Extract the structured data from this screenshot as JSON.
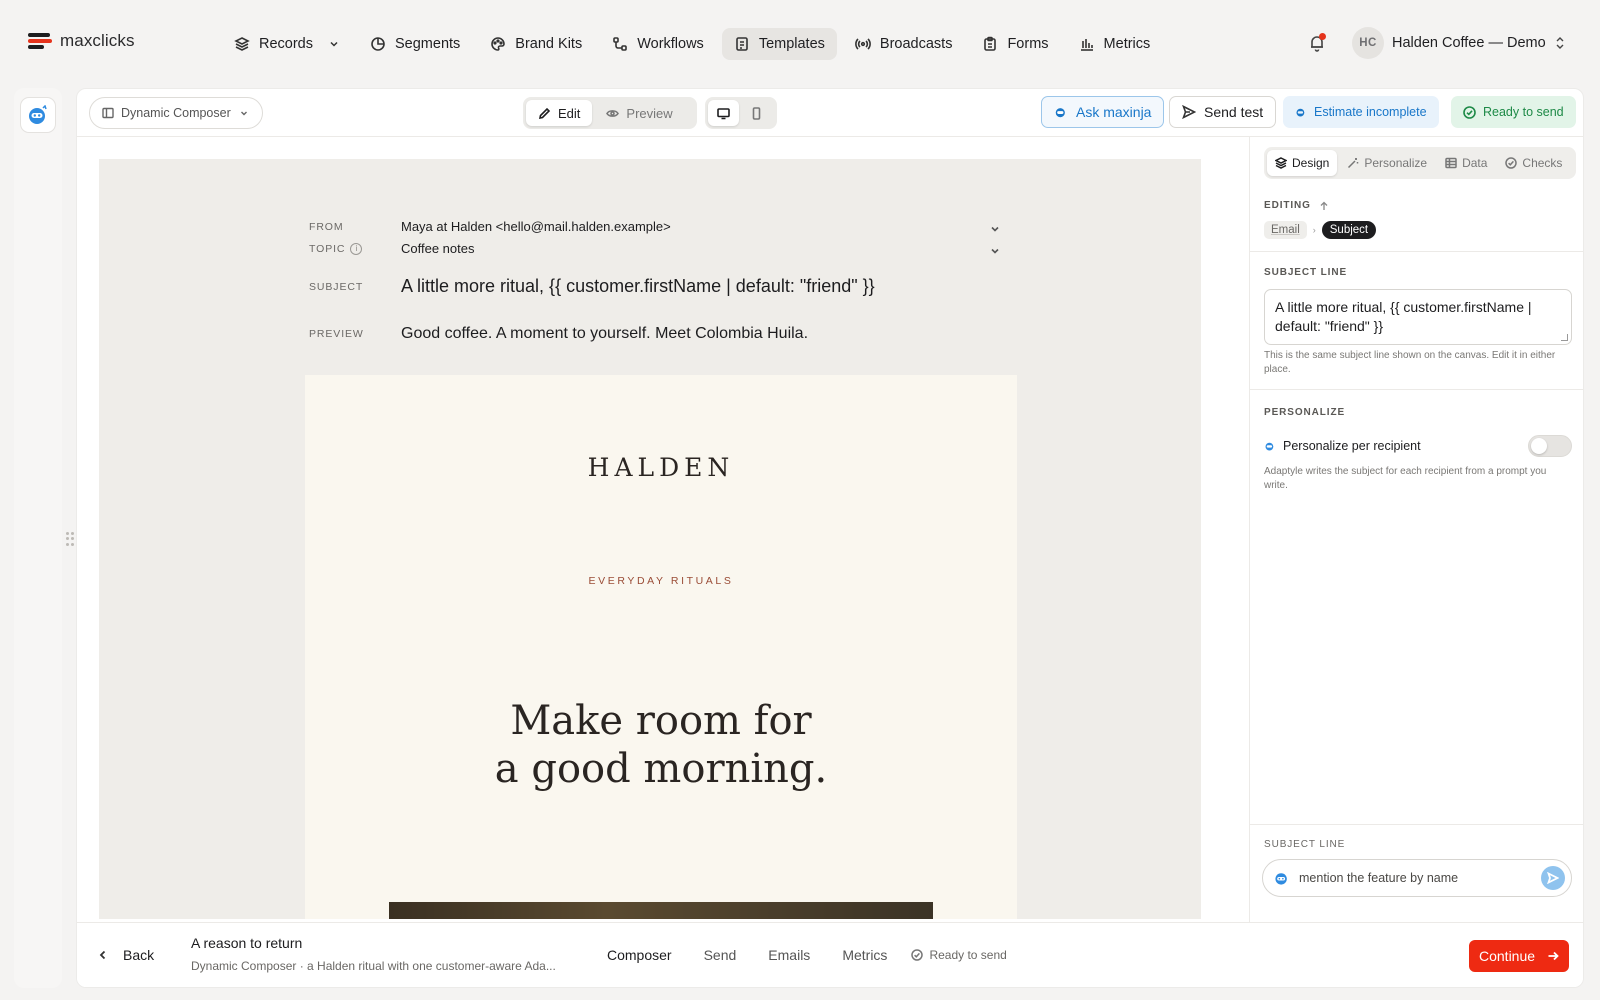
{
  "brand": {
    "name": "maxclicks"
  },
  "nav": {
    "items": [
      {
        "label": "Records",
        "icon": "layers-icon"
      },
      {
        "label": "Segments",
        "icon": "pie-icon"
      },
      {
        "label": "Brand Kits",
        "icon": "palette-icon"
      },
      {
        "label": "Workflows",
        "icon": "workflow-icon"
      },
      {
        "label": "Templates",
        "icon": "document-icon"
      },
      {
        "label": "Broadcasts",
        "icon": "broadcast-icon"
      },
      {
        "label": "Forms",
        "icon": "clipboard-icon"
      },
      {
        "label": "Metrics",
        "icon": "bar-chart-icon"
      }
    ],
    "active": "Templates"
  },
  "account": {
    "initials": "HC",
    "name": "Halden Coffee — Demo"
  },
  "toolbar": {
    "composer_label": "Dynamic Composer",
    "edit_label": "Edit",
    "preview_label": "Preview",
    "ask_label": "Ask maxinja",
    "send_test_label": "Send test",
    "estimate_label": "Estimate incomplete",
    "ready_label": "Ready to send"
  },
  "email": {
    "from_label": "FROM",
    "from_value": "Maya at Halden <hello@mail.halden.example>",
    "topic_label": "TOPIC",
    "topic_value": "Coffee notes",
    "subject_label": "SUBJECT",
    "subject_value": "A little more ritual, {{ customer.firstName | default: \"friend\" }}",
    "preview_label": "PREVIEW",
    "preview_value": "Good coffee. A moment to yourself. Meet Colombia Huila.",
    "wordmark": "HALDEN",
    "eyebrow": "EVERYDAY RITUALS",
    "headline_line1": "Make room for",
    "headline_line2": "a good morning."
  },
  "panel": {
    "tabs": [
      "Design",
      "Personalize",
      "Data",
      "Checks"
    ],
    "editing_label": "EDITING",
    "crumbs": [
      "Email",
      "Subject"
    ],
    "subject_line_label": "SUBJECT LINE",
    "subject_line_value": "A little more ritual, {{ customer.firstName | default: \"friend\" }}",
    "subject_help": "This is the same subject line shown on the canvas. Edit it in either place.",
    "personalize_label": "PERSONALIZE",
    "toggle_label": "Personalize per recipient",
    "toggle_on": false,
    "personalize_help": "Adaptyle writes the subject for each recipient from a prompt you write.",
    "prompt_label": "SUBJECT LINE",
    "prompt_value": "mention the feature by name"
  },
  "bottom": {
    "back_label": "Back",
    "doc_title": "A reason to return",
    "doc_subtitle": "Dynamic Composer · a Halden ritual with one customer-aware Ada...",
    "tabs": [
      "Composer",
      "Send",
      "Emails",
      "Metrics"
    ],
    "active_tab": "Composer",
    "status": "Ready to send",
    "continue_label": "Continue"
  },
  "colors": {
    "accent_red": "#ee2a12",
    "ask_blue": "#1977c9",
    "ready_green": "#1e8a47",
    "canvas_bg": "#efede9",
    "email_bg": "#faf7ef",
    "eyebrow": "#9a4c36"
  }
}
